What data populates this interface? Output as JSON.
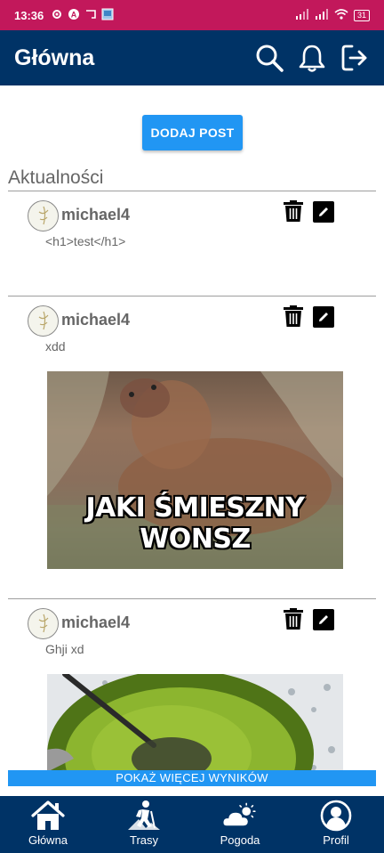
{
  "status_bar": {
    "time": "13:36",
    "left_icons": [
      "gear-icon",
      "android-icon",
      "cast-icon",
      "app-icon"
    ],
    "right_icons": [
      "signal-icon",
      "signal-icon",
      "wifi-icon",
      "battery-icon"
    ],
    "battery_level": "31"
  },
  "app_bar": {
    "title": "Główna",
    "actions": [
      "search-icon",
      "bell-icon",
      "logout-icon"
    ]
  },
  "main": {
    "add_post_label": "DODAJ POST",
    "section_title": "Aktualności",
    "posts": [
      {
        "author": "michael4",
        "body": "<h1>test</h1>"
      },
      {
        "author": "michael4",
        "body": "xdd",
        "image_caption": "JAKI ŚMIESZNY WONSZ"
      },
      {
        "author": "michael4",
        "body": "Ghji xd"
      }
    ],
    "show_more_label": "POKAŻ WIĘCEJ WYNIKÓW"
  },
  "bottom_nav": {
    "items": [
      {
        "label": "Główna",
        "icon": "home-icon"
      },
      {
        "label": "Trasy",
        "icon": "hiker-icon"
      },
      {
        "label": "Pogoda",
        "icon": "weather-icon"
      },
      {
        "label": "Profil",
        "icon": "profile-icon"
      }
    ]
  },
  "colors": {
    "status_bar": "#c2185b",
    "app_bar": "#003366",
    "accent": "#2196f3",
    "text_muted": "#666666"
  }
}
